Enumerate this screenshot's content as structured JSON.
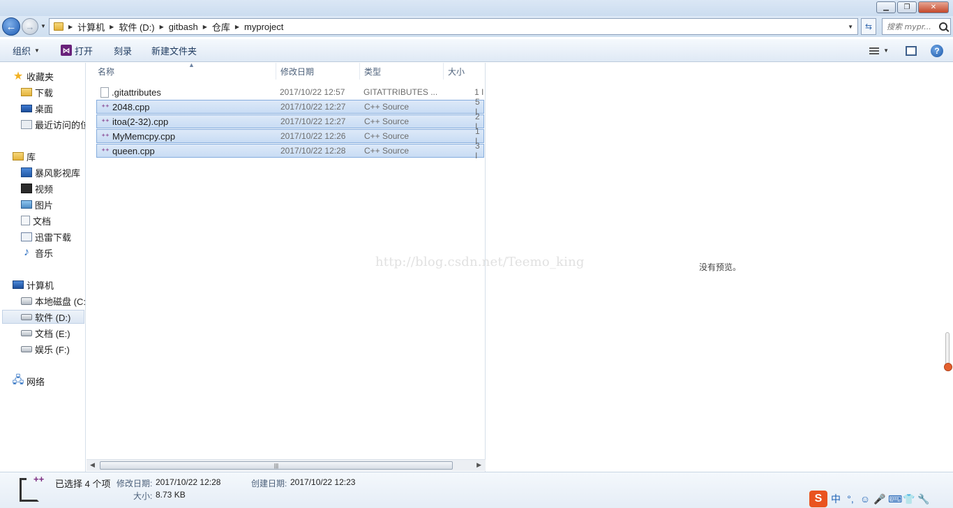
{
  "window": {
    "controls": [
      "minimize",
      "maximize",
      "close"
    ]
  },
  "address": {
    "breadcrumbs": [
      "计算机",
      "软件 (D:)",
      "gitbash",
      "仓库",
      "myproject"
    ],
    "search_placeholder": "搜索 mypr..."
  },
  "toolbar": {
    "organize": "组织",
    "open": "打开",
    "burn": "刻录",
    "new_folder": "新建文件夹"
  },
  "nav": {
    "favorites": {
      "label": "收藏夹",
      "items": [
        "下载",
        "桌面",
        "最近访问的位"
      ]
    },
    "libraries": {
      "label": "库",
      "items": [
        "暴风影视库",
        "视频",
        "图片",
        "文档",
        "迅雷下载",
        "音乐"
      ]
    },
    "computer": {
      "label": "计算机",
      "items": [
        "本地磁盘 (C:)",
        "软件 (D:)",
        "文档 (E:)",
        "娱乐 (F:)"
      ],
      "selected": "软件 (D:)"
    },
    "network": {
      "label": "网络"
    }
  },
  "columns": {
    "name": "名称",
    "date": "修改日期",
    "type": "类型",
    "size": "大小"
  },
  "files": [
    {
      "name": ".gitattributes",
      "date": "2017/10/22 12:57",
      "type": "GITATTRIBUTES ...",
      "size": "1 I",
      "selected": false
    },
    {
      "name": "2048.cpp",
      "date": "2017/10/22 12:27",
      "type": "C++ Source",
      "size": "5 I",
      "selected": true
    },
    {
      "name": "itoa(2-32).cpp",
      "date": "2017/10/22 12:27",
      "type": "C++ Source",
      "size": "2 I",
      "selected": true
    },
    {
      "name": "MyMemcpy.cpp",
      "date": "2017/10/22 12:26",
      "type": "C++ Source",
      "size": "1 I",
      "selected": true
    },
    {
      "name": "queen.cpp",
      "date": "2017/10/22 12:28",
      "type": "C++ Source",
      "size": "3 I",
      "selected": true
    }
  ],
  "preview": {
    "text": "没有预览。"
  },
  "watermark": "http://blog.csdn.net/Teemo_king",
  "details": {
    "title": "已选择 4 个项",
    "modified_label": "修改日期:",
    "modified_value": "2017/10/22 12:28",
    "created_label": "创建日期:",
    "created_value": "2017/10/22 12:23",
    "size_label": "大小:",
    "size_value": "8.73 KB"
  },
  "ime": {
    "logo": "S",
    "mode": "中",
    "punct": "°,",
    "items": [
      "emoji-icon",
      "mic-icon",
      "keyboard-icon",
      "shirt-icon",
      "wrench-icon"
    ]
  },
  "colors": {
    "selection": "#c8dcf4",
    "selection_border": "#84acdd",
    "accent": "#1f5cb3"
  }
}
